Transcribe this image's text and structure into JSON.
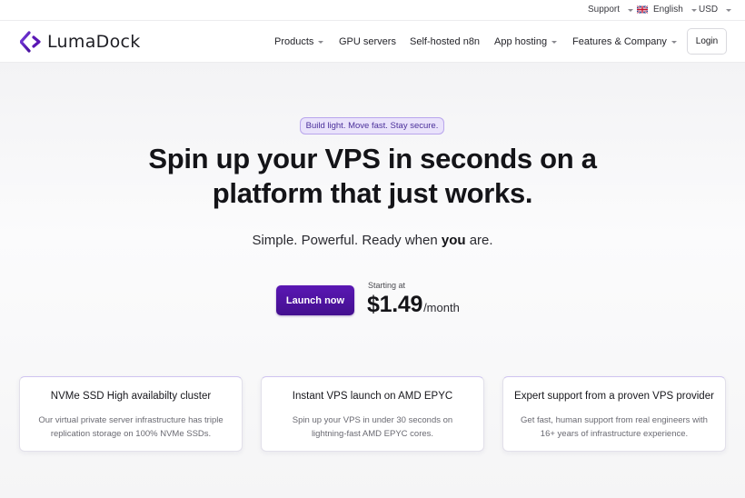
{
  "topbar": {
    "support_label": "Support",
    "language_label": "English",
    "currency_label": "USD"
  },
  "brand": {
    "name": "LumaDock",
    "accent_color": "#5a17b4"
  },
  "nav": {
    "items": [
      {
        "label": "Products",
        "has_dropdown": true
      },
      {
        "label": "GPU servers",
        "has_dropdown": false
      },
      {
        "label": "Self-hosted n8n",
        "has_dropdown": false
      },
      {
        "label": "App hosting",
        "has_dropdown": true
      },
      {
        "label": "Features & Company",
        "has_dropdown": true
      }
    ],
    "login_label": "Login"
  },
  "hero": {
    "tagline": "Build light. Move fast. Stay secure.",
    "title_line1": "Spin up your VPS in seconds on a",
    "title_line2": "platform that just works.",
    "subtitle_before": "Simple. Powerful. Ready when ",
    "subtitle_emphasis": "you",
    "subtitle_after": " are.",
    "cta_label": "Launch now",
    "price_caption": "Starting at",
    "price_amount": "$1.49",
    "price_period": "/month"
  },
  "features": [
    {
      "title": "NVMe SSD High availabilty cluster",
      "description": "Our virtual private server infrastructure has triple replication storage on 100% NVMe SSDs."
    },
    {
      "title": "Instant VPS launch on AMD EPYC",
      "description": "Spin up your VPS in under 30 seconds on lightning-fast AMD EPYC cores."
    },
    {
      "title": "Expert support from a proven VPS provider",
      "description": "Get fast, human support from real engineers with 16+ years of infrastructure experience."
    }
  ]
}
